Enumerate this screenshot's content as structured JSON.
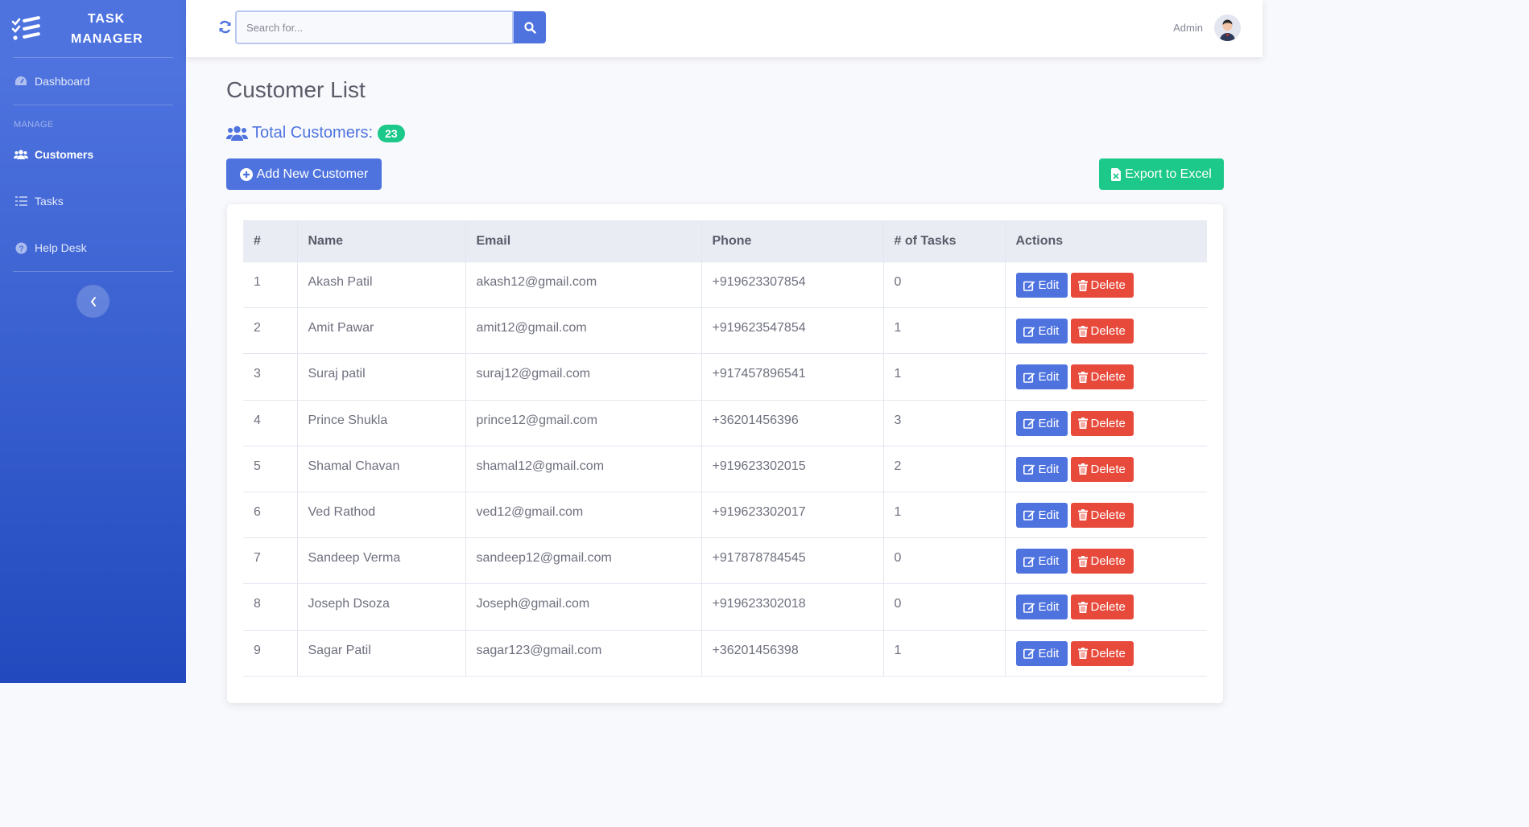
{
  "brand": {
    "line1": "TASK",
    "line2": "MANAGER"
  },
  "sidebar": {
    "dashboard": "Dashboard",
    "section_heading": "MANAGE",
    "items": [
      {
        "label": "Customers",
        "icon": "users-icon",
        "active": true
      },
      {
        "label": "Tasks",
        "icon": "list-icon",
        "active": false
      },
      {
        "label": "Help Desk",
        "icon": "question-circle-icon",
        "active": false
      }
    ]
  },
  "topbar": {
    "search_placeholder": "Search for...",
    "user_name": "Admin"
  },
  "page": {
    "title": "Customer List",
    "total_label": "Total Customers:",
    "total_count": "23",
    "add_button": "Add New Customer",
    "export_button": "Export to Excel"
  },
  "table": {
    "headers": [
      "#",
      "Name",
      "Email",
      "Phone",
      "# of Tasks",
      "Actions"
    ],
    "edit_label": "Edit",
    "delete_label": "Delete",
    "rows": [
      {
        "num": "1",
        "name": "Akash Patil",
        "email": "akash12@gmail.com",
        "phone": "+919623307854",
        "tasks": "0"
      },
      {
        "num": "2",
        "name": "Amit Pawar",
        "email": "amit12@gmail.com",
        "phone": "+919623547854",
        "tasks": "1"
      },
      {
        "num": "3",
        "name": "Suraj patil",
        "email": "suraj12@gmail.com",
        "phone": "+917457896541",
        "tasks": "1"
      },
      {
        "num": "4",
        "name": "Prince Shukla",
        "email": "prince12@gmail.com",
        "phone": "+36201456396",
        "tasks": "3"
      },
      {
        "num": "5",
        "name": "Shamal Chavan",
        "email": "shamal12@gmail.com",
        "phone": "+919623302015",
        "tasks": "2"
      },
      {
        "num": "6",
        "name": "Ved Rathod",
        "email": "ved12@gmail.com",
        "phone": "+919623302017",
        "tasks": "1"
      },
      {
        "num": "7",
        "name": "Sandeep Verma",
        "email": "sandeep12@gmail.com",
        "phone": "+917878784545",
        "tasks": "0"
      },
      {
        "num": "8",
        "name": "Joseph Dsoza",
        "email": "Joseph@gmail.com",
        "phone": "+919623302018",
        "tasks": "0"
      },
      {
        "num": "9",
        "name": "Sagar Patil",
        "email": "sagar123@gmail.com",
        "phone": "+36201456398",
        "tasks": "1"
      }
    ]
  },
  "colors": {
    "primary": "#4e73df",
    "success": "#1cc88a",
    "danger": "#e74a3b"
  }
}
